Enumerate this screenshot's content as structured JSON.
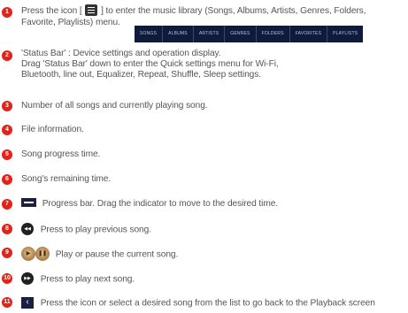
{
  "items": [
    {
      "num": "1",
      "line1_before": "Press the icon [",
      "line1_after": "] to enter the music library (Songs, Albums, Artists, Genres, Folders,",
      "line2": "Favorite, Playlists) menu.",
      "icon": "menu-icon"
    },
    {
      "num": "2",
      "lines": [
        "'Status Bar' : Device settings and operation display.",
        "Drag 'Status Bar' down to enter the Quick settings menu for Wi-Fi,",
        "Bluetooth, line out, Equalizer, Repeat, Shuffle, Sleep settings."
      ]
    },
    {
      "num": "3",
      "text": "Number of all songs and currently playing song."
    },
    {
      "num": "4",
      "text": "File information."
    },
    {
      "num": "5",
      "text": "Song progress time."
    },
    {
      "num": "6",
      "text": "Song's remaining time."
    },
    {
      "num": "7",
      "text": "Progress bar. Drag the indicator to move to the desired time.",
      "icon": "progress-bar-icon"
    },
    {
      "num": "8",
      "text": "Press to play previous song.",
      "icon": "previous-icon"
    },
    {
      "num": "9",
      "text": "Play or pause the current song.",
      "icon": "play-pause-icon"
    },
    {
      "num": "10",
      "text": "Press to play next song.",
      "icon": "next-icon"
    },
    {
      "num": "11",
      "text": "Press the icon or select a desired song from the list to go back to the Playback screen",
      "icon": "back-icon"
    }
  ],
  "library_tabs": [
    "SONGS",
    "ALBUMS",
    "ARTISTS",
    "GENRES",
    "FOLDERS",
    "FAVORITES",
    "PLAYLISTS"
  ],
  "colors": {
    "badge": "#e2231a",
    "text": "#555555",
    "tab_bar": "#0f1b3c"
  }
}
